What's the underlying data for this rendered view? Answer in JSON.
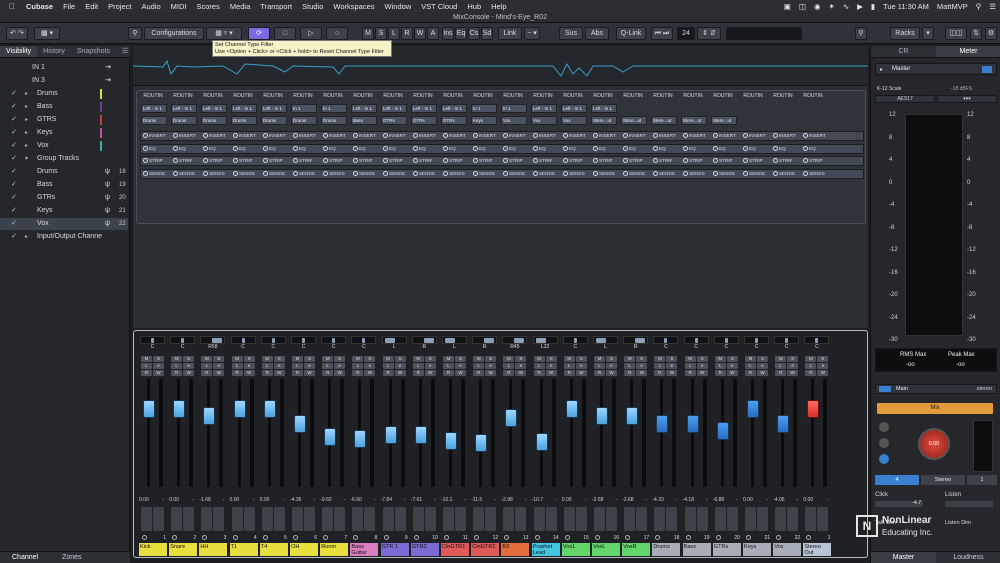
{
  "menubar": {
    "app": "Cubase",
    "items": [
      "File",
      "Edit",
      "Project",
      "Audio",
      "MIDI",
      "Scores",
      "Media",
      "Transport",
      "Studio",
      "Workspaces",
      "Window",
      "VST Cloud",
      "Hub",
      "Help"
    ],
    "time": "Tue 11:30 AM",
    "user": "MattMVP"
  },
  "window": {
    "title": "MixConsole - Mind's-Eye_R02"
  },
  "toolbar": {
    "configurations": "Configurations",
    "mode_buttons": [
      "M",
      "S",
      "L",
      "R",
      "W",
      "A"
    ],
    "section_buttons": [
      "Ins",
      "Eq",
      "Cs",
      "Sd"
    ],
    "link": "Link",
    "sus": "Sus",
    "abs": "Abs",
    "qlink": "Q-Link",
    "number": "24",
    "racks": "Racks"
  },
  "tooltip": {
    "line1": "Set Channel Type Filter",
    "line2": "Use <Option + Click> or <Click + hold> to Reset Channel Type Filter"
  },
  "left_panel": {
    "tabs": [
      "Visibility",
      "History",
      "Snapshots"
    ],
    "rows": [
      {
        "label": "IN 1",
        "checked": false,
        "arrow": "",
        "indent": 0,
        "color": "",
        "icon": "",
        "num": ""
      },
      {
        "label": "IN 3",
        "checked": false,
        "arrow": "",
        "indent": 0,
        "color": "",
        "icon": "",
        "num": ""
      },
      {
        "label": "Drums",
        "checked": true,
        "arrow": "▸",
        "indent": 0,
        "color": "#e0d845",
        "icon": "",
        "num": ""
      },
      {
        "label": "Bass",
        "checked": true,
        "arrow": "▸",
        "indent": 0,
        "color": "#6d3f9a",
        "icon": "",
        "num": ""
      },
      {
        "label": "GTRS",
        "checked": true,
        "arrow": "▸",
        "indent": 0,
        "color": "#c83a3a",
        "icon": "",
        "num": ""
      },
      {
        "label": "Keys",
        "checked": true,
        "arrow": "▸",
        "indent": 0,
        "color": "#c0509a",
        "icon": "",
        "num": ""
      },
      {
        "label": "Vox",
        "checked": true,
        "arrow": "▸",
        "indent": 0,
        "color": "#3ab0a0",
        "icon": "",
        "num": ""
      },
      {
        "label": "Group Tracks",
        "checked": true,
        "arrow": "▾",
        "indent": 0,
        "color": "",
        "icon": "",
        "num": ""
      },
      {
        "label": "Drums",
        "checked": true,
        "arrow": "",
        "indent": 1,
        "color": "",
        "icon": "ψ",
        "num": "18"
      },
      {
        "label": "Bass",
        "checked": true,
        "arrow": "",
        "indent": 1,
        "color": "",
        "icon": "ψ",
        "num": "19"
      },
      {
        "label": "GTRs",
        "checked": true,
        "arrow": "",
        "indent": 1,
        "color": "",
        "icon": "ψ",
        "num": "20"
      },
      {
        "label": "Keys",
        "checked": true,
        "arrow": "",
        "indent": 1,
        "color": "",
        "icon": "ψ",
        "num": "21"
      },
      {
        "label": "Vox",
        "checked": true,
        "arrow": "",
        "indent": 1,
        "color": "",
        "icon": "ψ",
        "num": "22"
      },
      {
        "label": "Input/Output Channe",
        "checked": true,
        "arrow": "▸",
        "indent": 0,
        "color": "",
        "icon": "",
        "num": ""
      }
    ],
    "bottom_tabs": [
      "Channel",
      "Zones"
    ]
  },
  "racks": {
    "routing_header": "ROUTIN",
    "inputs": [
      "Left - In 1",
      "Left - In 1",
      "Left - In 1",
      "Left - In 1",
      "Left - In 1",
      "In 1",
      "In 1",
      "Left - In 1",
      "Left - In 1",
      "Left - In 1",
      "Left - In 1",
      "In 1",
      "In 1",
      "Left - In 1",
      "Left - In 1",
      "Left - In 1"
    ],
    "outputs": [
      "Drums",
      "Drums",
      "Drums",
      "Drums",
      "Drums",
      "Drums",
      "Drums",
      "Bass",
      "GTRs",
      "GTRs",
      "GTRs",
      "Keys",
      "Vox",
      "Vox",
      "Vox",
      "Stere...ut",
      "Stere...ut",
      "Stere...ut",
      "Stere...ut",
      "Stere...ut"
    ],
    "rows": [
      "INSERT",
      "EQ",
      "STRIP",
      "SENDS"
    ]
  },
  "channels": [
    {
      "name": "Kick",
      "pan": "C",
      "vol": "0.00",
      "num": "1",
      "color": "#e8df3e",
      "fader": 0.72
    },
    {
      "name": "Snare",
      "pan": "C",
      "vol": "0.00",
      "num": "2",
      "color": "#e8df3e",
      "fader": 0.72
    },
    {
      "name": "HH",
      "pan": "R58",
      "vol": "-1.68",
      "num": "3",
      "color": "#e8df3e",
      "fader": 0.66
    },
    {
      "name": "T1",
      "pan": "C",
      "vol": "0.00",
      "num": "4",
      "color": "#e8df3e",
      "fader": 0.72
    },
    {
      "name": "T4",
      "pan": "C",
      "vol": "0.00",
      "num": "5",
      "color": "#e8df3e",
      "fader": 0.72
    },
    {
      "name": "OH",
      "pan": "C",
      "vol": "-4.36",
      "num": "6",
      "color": "#e8df3e",
      "fader": 0.58
    },
    {
      "name": "Room",
      "pan": "C",
      "vol": "-9.60",
      "num": "7",
      "color": "#e8df3e",
      "fader": 0.46
    },
    {
      "name": "Bass Guitar",
      "pan": "C",
      "vol": "-6.60",
      "num": "8",
      "color": "#d97fc0",
      "fader": 0.44
    },
    {
      "name": "GTR 1",
      "pan": "L",
      "vol": "-7.84",
      "num": "9",
      "color": "#7a6ad2",
      "fader": 0.48
    },
    {
      "name": "GTR2",
      "pan": "R",
      "vol": "-7.61",
      "num": "10",
      "color": "#7a6ad2",
      "fader": 0.48
    },
    {
      "name": "ClnGTR1",
      "pan": "L",
      "vol": "-10.1",
      "num": "11",
      "color": "#e05a5a",
      "fader": 0.43
    },
    {
      "name": "ClnGTR2",
      "pan": "R",
      "vol": "-11.5",
      "num": "12",
      "color": "#e05a5a",
      "fader": 0.41
    },
    {
      "name": "B3",
      "pan": "R45",
      "vol": "-2.98",
      "num": "13",
      "color": "#e26d3a",
      "fader": 0.64
    },
    {
      "name": "Prophet Lead",
      "pan": "L32",
      "vol": "-10.7",
      "num": "14",
      "color": "#43c7e0",
      "fader": 0.42
    },
    {
      "name": "Vox1",
      "pan": "C",
      "vol": "0.00",
      "num": "15",
      "color": "#62d66a",
      "fader": 0.72
    },
    {
      "name": "VoxL",
      "pan": "L",
      "vol": "-2.68",
      "num": "16",
      "color": "#62d66a",
      "fader": 0.66
    },
    {
      "name": "VoxR",
      "pan": "R",
      "vol": "-2.68",
      "num": "17",
      "color": "#62d66a",
      "fader": 0.66
    },
    {
      "name": "Drums",
      "pan": "C",
      "vol": "-4.33",
      "num": "18",
      "color": "#a8aeb8",
      "fader": 0.58
    },
    {
      "name": "Bass",
      "pan": "C",
      "vol": "-4.18",
      "num": "19",
      "color": "#a8aeb8",
      "fader": 0.58
    },
    {
      "name": "GTRs",
      "pan": "C",
      "vol": "-6.88",
      "num": "20",
      "color": "#a8aeb8",
      "fader": 0.52
    },
    {
      "name": "Keys",
      "pan": "C",
      "vol": "0.00",
      "num": "21",
      "color": "#a8aeb8",
      "fader": 0.72
    },
    {
      "name": "Vox",
      "pan": "C",
      "vol": "-4.05",
      "num": "22",
      "color": "#a8aeb8",
      "fader": 0.58
    },
    {
      "name": "Stereo Out",
      "pan": "C",
      "vol": "0.00",
      "num": "1",
      "color": "#b9c4d6",
      "fader": 0.72
    }
  ],
  "right_panel": {
    "tabs": [
      "CR",
      "Meter"
    ],
    "master": "Master",
    "k12": "K-12 Scale",
    "k12_val": "-18 dBFS",
    "aes": "AES17",
    "scale": [
      "12",
      "8",
      "4",
      "0",
      "-4",
      "-8",
      "-12",
      "-16",
      "-20",
      "-24",
      "-30"
    ],
    "rms_label": "RMS Max",
    "rms_val": "-oo",
    "peak_label": "Peak Max",
    "peak_val": "-oo",
    "main": "Main",
    "stereo": "stereo",
    "mix": "Mix",
    "knob_val": "0.00",
    "dim_val": "4",
    "stereo_sel": "Stereo",
    "one": "1",
    "click": "Click",
    "click_val": "-4.7",
    "listen": "Listen",
    "talk": "Talk Dim",
    "listen_dim": "Listen Dim",
    "bottom_tabs": [
      "Master",
      "Loudness"
    ]
  },
  "watermark": {
    "line1": "NonLinear",
    "line2": "Educating Inc."
  }
}
